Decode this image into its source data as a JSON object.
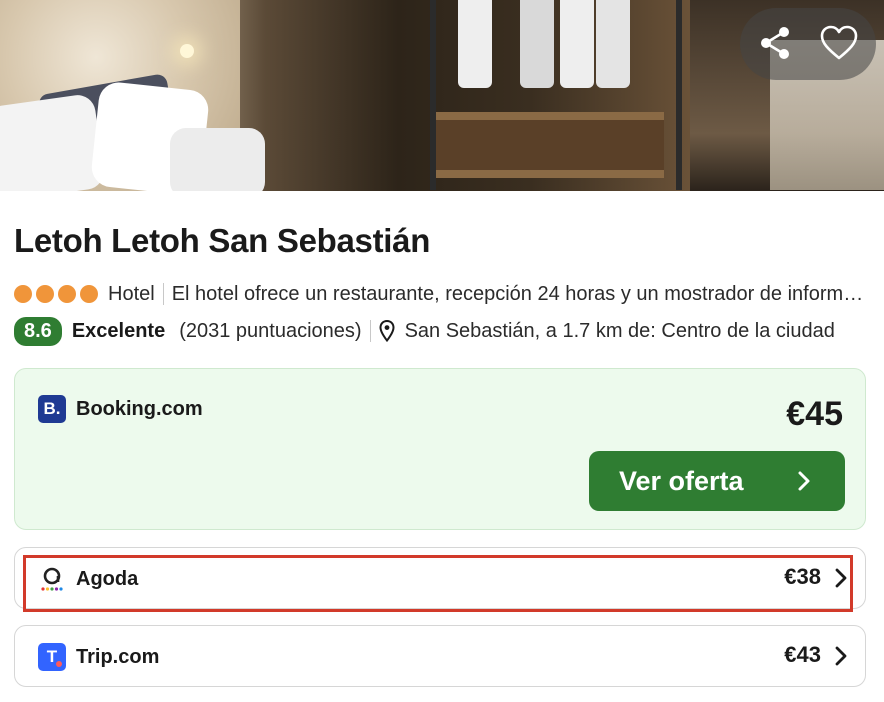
{
  "hotel": {
    "name": "Letoh Letoh San Sebastián",
    "stars": 4,
    "type": "Hotel",
    "description": "El hotel ofrece un restaurante, recepción 24 horas y un mostrador de información turística",
    "score": "8.6",
    "rating_word": "Excelente",
    "reviews": "(2031 puntuaciones)",
    "location": "San Sebastián, a 1.7 km de: Centro de la ciudad"
  },
  "hero_actions": {
    "share_icon": "share-icon",
    "favorite_icon": "heart-icon"
  },
  "featured_offer": {
    "provider": "Booking.com",
    "logo_letter": "B.",
    "price": "€45",
    "cta_label": "Ver oferta"
  },
  "offers": [
    {
      "provider": "Agoda",
      "price": "€38"
    },
    {
      "provider": "Trip.com",
      "logo_letter": "T",
      "price": "€43"
    }
  ],
  "colors": {
    "accent_green": "#2f7d32",
    "star_orange": "#f0953a",
    "featured_bg": "#edfaed",
    "highlight_red": "#d23a2a"
  }
}
